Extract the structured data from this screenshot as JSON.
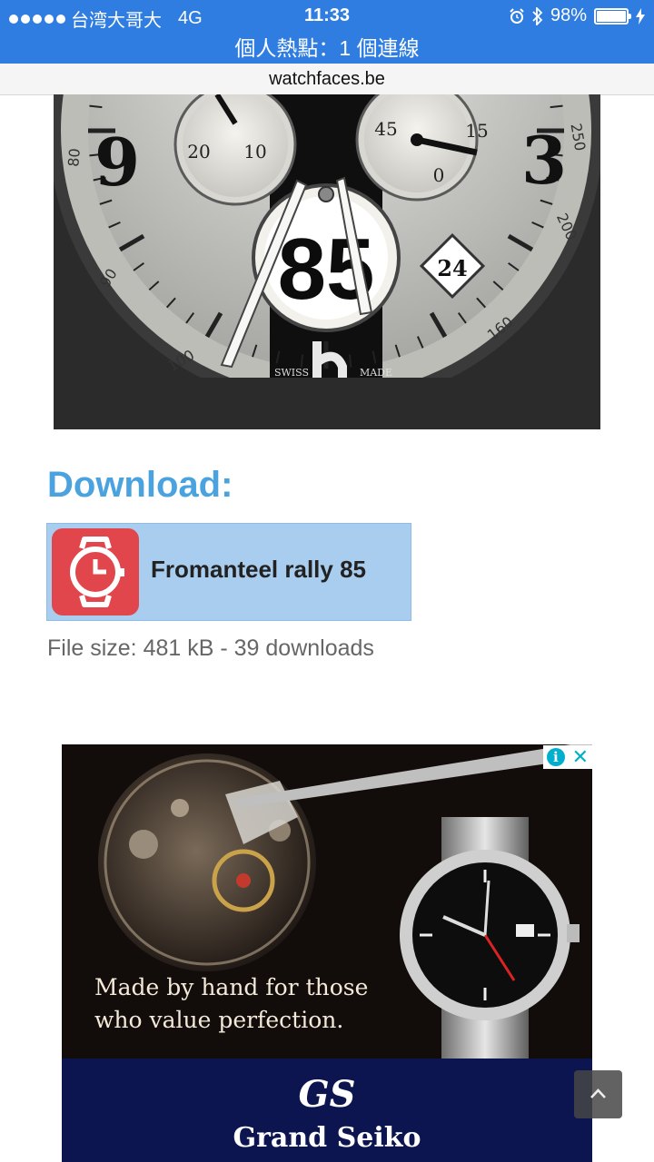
{
  "status_bar": {
    "carrier": "台湾大哥大",
    "network": "4G",
    "time": "11:33",
    "battery": "98%",
    "hotspot": "個人熱點：1 個連線"
  },
  "url_bar": {
    "domain": "watchfaces.be"
  },
  "watch_face": {
    "dial_numbers": [
      "9",
      "3"
    ],
    "left_subdial": [
      "20",
      "10"
    ],
    "right_subdial": [
      "45",
      "15",
      "0"
    ],
    "center_number": "85",
    "date": "24",
    "tachymeter": [
      "80",
      "90",
      "100",
      "250",
      "200",
      "160"
    ],
    "dial_text": [
      "SWISS",
      "MADE"
    ]
  },
  "download": {
    "heading": "Download:",
    "app_name": "Fromanteel rally 85",
    "file_info": "File size: 481 kB - 39 downloads"
  },
  "ad": {
    "line1": "Made by hand for those",
    "line2": "who value perfection.",
    "logo": "GS",
    "brand": "Grand Seiko",
    "info_symbol": "i",
    "close_symbol": "✕"
  },
  "colors": {
    "status_bar": "#2f7de1",
    "heading": "#4aa3df",
    "download_card": "#a9cdee",
    "app_icon": "#e0464b",
    "ad_band": "#0c1550"
  },
  "icons": [
    "alarm-icon",
    "bluetooth-icon",
    "battery-icon",
    "charging-icon",
    "watch-icon",
    "info-icon",
    "close-icon",
    "chevron-up-icon"
  ]
}
